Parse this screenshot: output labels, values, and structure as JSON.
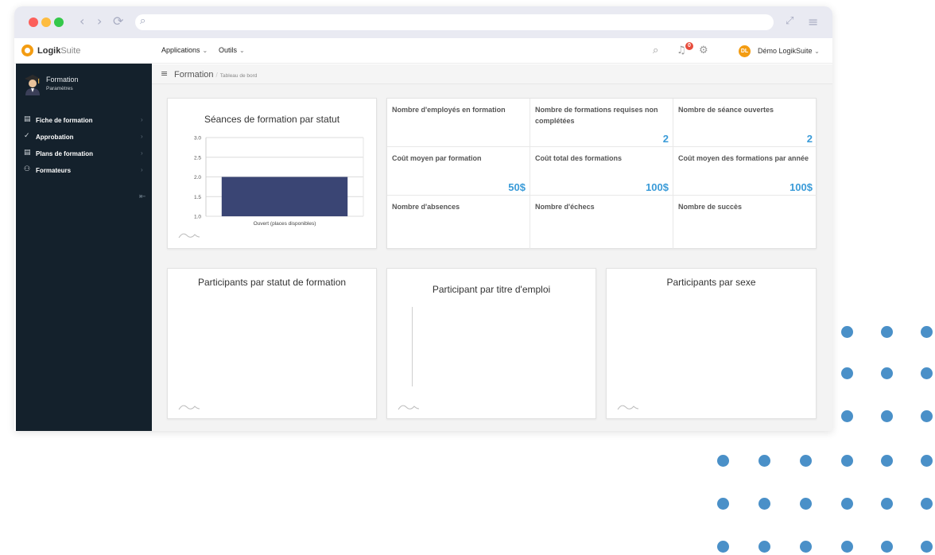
{
  "app": {
    "logo_bold": "Logik",
    "logo_thin": "Suite",
    "menu": [
      {
        "label": "Applications"
      },
      {
        "label": "Outils"
      }
    ],
    "notification_count": "0",
    "user_initials": "DL",
    "user_name": "Démo LogikSuite"
  },
  "sidebar": {
    "title": "Formation",
    "subtitle": "Paramètres",
    "items": [
      {
        "label": "Fiche de formation",
        "icon": "list-icon"
      },
      {
        "label": "Approbation",
        "icon": "check-icon"
      },
      {
        "label": "Plans de formation",
        "icon": "list-icon"
      },
      {
        "label": "Formateurs",
        "icon": "people-icon"
      }
    ]
  },
  "breadcrumb": {
    "main": "Formation",
    "sub": "Tableau de bord"
  },
  "chart_panel": {
    "title": "Séances de formation par statut"
  },
  "chart_data": {
    "type": "bar",
    "title": "Séances de formation par statut",
    "categories": [
      "Ouvert (places disponibles)"
    ],
    "values": [
      2
    ],
    "ylim": [
      1.0,
      3.0
    ],
    "yticks": [
      "3.0",
      "2.5",
      "2.0",
      "1.5",
      "1.0"
    ],
    "grid": true,
    "bar_color": "#3a4574"
  },
  "kpis": [
    {
      "label": "Nombre d'employés en formation",
      "value": ""
    },
    {
      "label": "Nombre de formations requises non complétées",
      "value": "2"
    },
    {
      "label": "Nombre de séance ouvertes",
      "value": "2"
    },
    {
      "label": "Coût moyen par formation",
      "value": "50$"
    },
    {
      "label": "Coût total des formations",
      "value": "100$"
    },
    {
      "label": "Coût moyen des formations par année",
      "value": "100$"
    },
    {
      "label": "Nombre d'absences",
      "value": ""
    },
    {
      "label": "Nombre d'échecs",
      "value": ""
    },
    {
      "label": "Nombre de succès",
      "value": ""
    }
  ],
  "bottom_panels": [
    {
      "title": "Participants par statut de formation"
    },
    {
      "title": "Participant par titre d'emploi"
    },
    {
      "title": "Participants par sexe"
    }
  ],
  "colors": {
    "accent": "#3a9bd8",
    "sidebar_bg": "#14212c",
    "brand": "#f39c12",
    "decor_dots": "#4a90c8"
  }
}
